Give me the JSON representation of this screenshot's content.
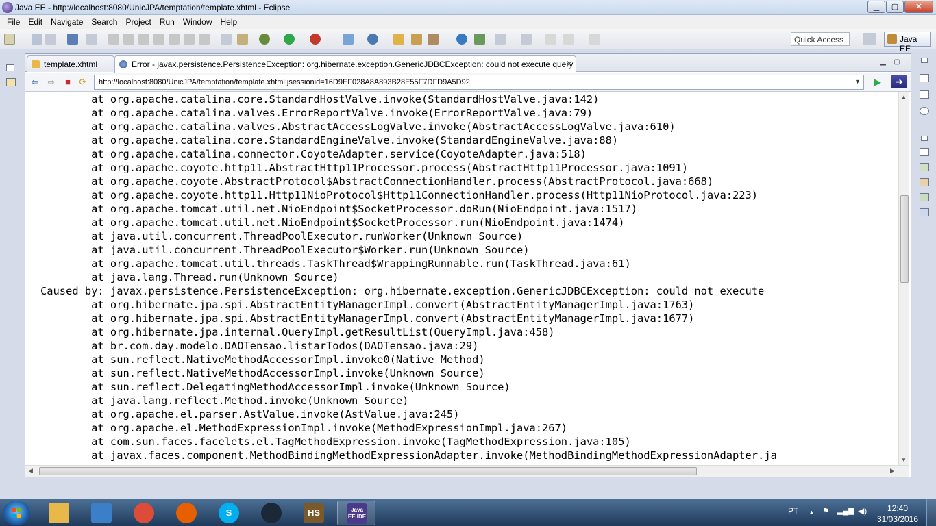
{
  "window": {
    "title": "Java EE - http://localhost:8080/UnicJPA/temptation/template.xhtml - Eclipse",
    "min": "▁",
    "max": "▢",
    "close": "✕"
  },
  "menu": [
    "File",
    "Edit",
    "Navigate",
    "Search",
    "Project",
    "Run",
    "Window",
    "Help"
  ],
  "toolbar": {
    "quick_access": "Quick Access",
    "perspective": "Java EE"
  },
  "tabs": [
    {
      "label": "template.xhtml"
    },
    {
      "label": "Error - javax.persistence.PersistenceException: org.hibernate.exception.GenericJDBCException: could not execute query",
      "close": "✕"
    }
  ],
  "browser": {
    "url": "http://localhost:8080/UnicJPA/temptation/template.xhtml;jsessionid=16D9EF028A8A893B28E55F7DFD9A5D92",
    "back": "⇦",
    "forward": "⇨",
    "stop": "■",
    "refresh": "⟳",
    "dropdown": "▼",
    "go": "▶",
    "external": "➜"
  },
  "trace_lines": [
    "        at org.apache.catalina.core.StandardHostValve.invoke(StandardHostValve.java:142)",
    "        at org.apache.catalina.valves.ErrorReportValve.invoke(ErrorReportValve.java:79)",
    "        at org.apache.catalina.valves.AbstractAccessLogValve.invoke(AbstractAccessLogValve.java:610)",
    "        at org.apache.catalina.core.StandardEngineValve.invoke(StandardEngineValve.java:88)",
    "        at org.apache.catalina.connector.CoyoteAdapter.service(CoyoteAdapter.java:518)",
    "        at org.apache.coyote.http11.AbstractHttp11Processor.process(AbstractHttp11Processor.java:1091)",
    "        at org.apache.coyote.AbstractProtocol$AbstractConnectionHandler.process(AbstractProtocol.java:668)",
    "        at org.apache.coyote.http11.Http11NioProtocol$Http11ConnectionHandler.process(Http11NioProtocol.java:223)",
    "        at org.apache.tomcat.util.net.NioEndpoint$SocketProcessor.doRun(NioEndpoint.java:1517)",
    "        at org.apache.tomcat.util.net.NioEndpoint$SocketProcessor.run(NioEndpoint.java:1474)",
    "        at java.util.concurrent.ThreadPoolExecutor.runWorker(Unknown Source)",
    "        at java.util.concurrent.ThreadPoolExecutor$Worker.run(Unknown Source)",
    "        at org.apache.tomcat.util.threads.TaskThread$WrappingRunnable.run(TaskThread.java:61)",
    "        at java.lang.Thread.run(Unknown Source)",
    "Caused by: javax.persistence.PersistenceException: org.hibernate.exception.GenericJDBCException: could not execute",
    "        at org.hibernate.jpa.spi.AbstractEntityManagerImpl.convert(AbstractEntityManagerImpl.java:1763)",
    "        at org.hibernate.jpa.spi.AbstractEntityManagerImpl.convert(AbstractEntityManagerImpl.java:1677)",
    "        at org.hibernate.jpa.internal.QueryImpl.getResultList(QueryImpl.java:458)",
    "        at br.com.day.modelo.DAOTensao.listarTodos(DAOTensao.java:29)",
    "        at sun.reflect.NativeMethodAccessorImpl.invoke0(Native Method)",
    "        at sun.reflect.NativeMethodAccessorImpl.invoke(Unknown Source)",
    "        at sun.reflect.DelegatingMethodAccessorImpl.invoke(Unknown Source)",
    "        at java.lang.reflect.Method.invoke(Unknown Source)",
    "        at org.apache.el.parser.AstValue.invoke(AstValue.java:245)",
    "        at org.apache.el.MethodExpressionImpl.invoke(MethodExpressionImpl.java:267)",
    "        at com.sun.faces.facelets.el.TagMethodExpression.invoke(TagMethodExpression.java:105)",
    "        at javax.faces.component.MethodBindingMethodExpressionAdapter.invoke(MethodBindingMethodExpressionAdapter.ja"
  ],
  "taskbar": {
    "apps": [
      {
        "name": "explorer",
        "label": "",
        "color": "#e8b84a"
      },
      {
        "name": "media",
        "label": "",
        "color": "#3a7fc8"
      },
      {
        "name": "chrome",
        "label": "",
        "color": "#dd4b39"
      },
      {
        "name": "firefox",
        "label": "",
        "color": "#e66000"
      },
      {
        "name": "skype",
        "label": "S",
        "color": "#00aff0"
      },
      {
        "name": "steam",
        "label": "",
        "color": "#1b2838"
      },
      {
        "name": "hearthstone",
        "label": "HS",
        "color": "#7a5a2a"
      },
      {
        "name": "eclipse",
        "label": "Java EE IDE",
        "color": "#4b3a8a"
      }
    ],
    "lang": "PT",
    "time": "12:40",
    "date": "31/03/2016"
  },
  "colors": {
    "accent": "#3b2b7a",
    "taskbar": "#1f3a5b"
  }
}
